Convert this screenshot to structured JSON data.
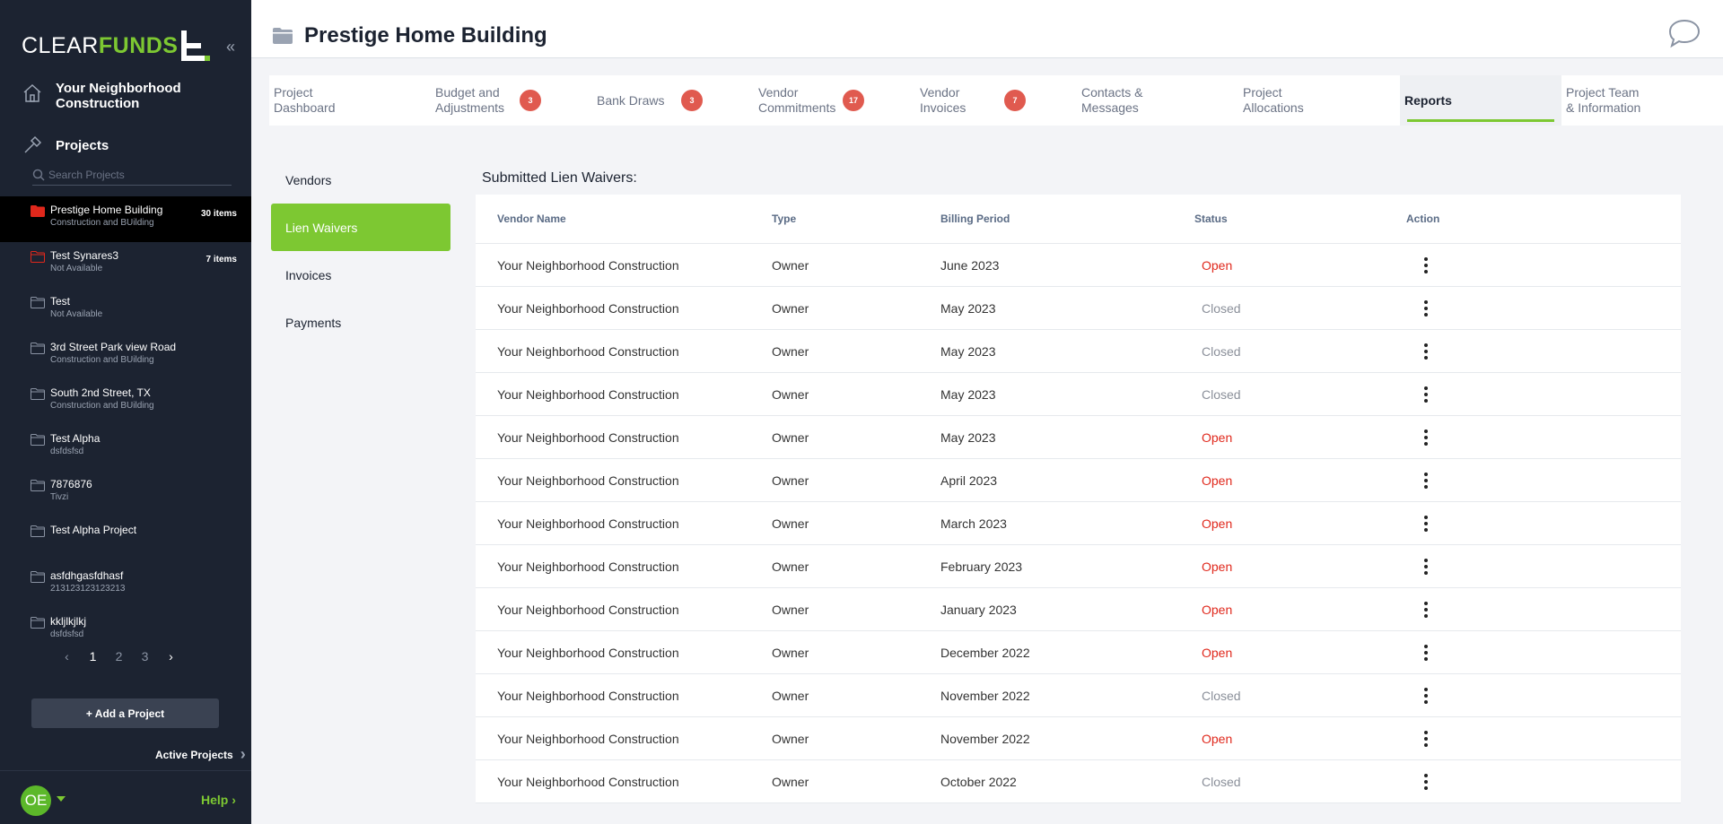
{
  "brand": {
    "clear": "CLEAR",
    "funds": "FUNDS"
  },
  "sidebar": {
    "org_name": "Your Neighborhood Construction",
    "projects_label": "Projects",
    "search_placeholder": "Search Projects",
    "projects": [
      {
        "name": "Prestige Home Building",
        "sub": "Construction and BUilding",
        "count": "30 items",
        "active": true,
        "icon_color": "#e0281c"
      },
      {
        "name": "Test Synares3",
        "sub": "Not Available",
        "count": "7 items",
        "active": false,
        "icon_color": "#e0281c"
      },
      {
        "name": "Test",
        "sub": "Not Available",
        "count": "",
        "active": false,
        "icon_color": "#8a93a3"
      },
      {
        "name": "3rd Street Park view Road",
        "sub": "Construction and BUilding",
        "count": "",
        "active": false,
        "icon_color": "#8a93a3"
      },
      {
        "name": "South 2nd Street, TX",
        "sub": "Construction and BUilding",
        "count": "",
        "active": false,
        "icon_color": "#8a93a3"
      },
      {
        "name": "Test Alpha",
        "sub": "dsfdsfsd",
        "count": "",
        "active": false,
        "icon_color": "#8a93a3"
      },
      {
        "name": "7876876",
        "sub": "Tivzi",
        "count": "",
        "active": false,
        "icon_color": "#8a93a3"
      },
      {
        "name": "Test Alpha Project",
        "sub": "",
        "count": "",
        "active": false,
        "icon_color": "#8a93a3"
      },
      {
        "name": "asfdhgasfdhasf",
        "sub": "213123123123213",
        "count": "",
        "active": false,
        "icon_color": "#8a93a3"
      },
      {
        "name": "kkljlkjlkj",
        "sub": "dsfdsfsd",
        "count": "",
        "active": false,
        "icon_color": "#8a93a3"
      }
    ],
    "pages": [
      "1",
      "2",
      "3"
    ],
    "current_page": "1",
    "add_project": "+ Add a Project",
    "active_projects": "Active Projects",
    "avatar_initials": "OE",
    "help": "Help"
  },
  "header": {
    "title": "Prestige Home Building"
  },
  "tabs": [
    {
      "label": "Project Dashboard",
      "badge": ""
    },
    {
      "label": "Budget and Adjustments",
      "badge": "3"
    },
    {
      "label": "Bank Draws",
      "badge": "3"
    },
    {
      "label": "Vendor Commitments",
      "badge": "17"
    },
    {
      "label": "Vendor Invoices",
      "badge": "7"
    },
    {
      "label": "Contacts & Messages",
      "badge": ""
    },
    {
      "label": "Project Allocations",
      "badge": ""
    },
    {
      "label": "Reports",
      "badge": "",
      "active": true
    },
    {
      "label": "Project Team & Information",
      "badge": ""
    }
  ],
  "subnav": [
    {
      "label": "Vendors",
      "active": false
    },
    {
      "label": "Lien Waivers",
      "active": true
    },
    {
      "label": "Invoices",
      "active": false
    },
    {
      "label": "Payments",
      "active": false
    }
  ],
  "section_title": "Submitted Lien Waivers:",
  "table": {
    "headers": [
      "Vendor Name",
      "Type",
      "Billing Period",
      "Status",
      "Action"
    ],
    "rows": [
      {
        "vendor": "Your Neighborhood Construction",
        "type": "Owner",
        "period": "June 2023",
        "status": "Open"
      },
      {
        "vendor": "Your Neighborhood Construction",
        "type": "Owner",
        "period": "May 2023",
        "status": "Closed"
      },
      {
        "vendor": "Your Neighborhood Construction",
        "type": "Owner",
        "period": "May 2023",
        "status": "Closed"
      },
      {
        "vendor": "Your Neighborhood Construction",
        "type": "Owner",
        "period": "May 2023",
        "status": "Closed"
      },
      {
        "vendor": "Your Neighborhood Construction",
        "type": "Owner",
        "period": "May 2023",
        "status": "Open"
      },
      {
        "vendor": "Your Neighborhood Construction",
        "type": "Owner",
        "period": "April 2023",
        "status": "Open"
      },
      {
        "vendor": "Your Neighborhood Construction",
        "type": "Owner",
        "period": "March 2023",
        "status": "Open"
      },
      {
        "vendor": "Your Neighborhood Construction",
        "type": "Owner",
        "period": "February 2023",
        "status": "Open"
      },
      {
        "vendor": "Your Neighborhood Construction",
        "type": "Owner",
        "period": "January 2023",
        "status": "Open"
      },
      {
        "vendor": "Your Neighborhood Construction",
        "type": "Owner",
        "period": "December 2022",
        "status": "Open"
      },
      {
        "vendor": "Your Neighborhood Construction",
        "type": "Owner",
        "period": "November 2022",
        "status": "Closed"
      },
      {
        "vendor": "Your Neighborhood Construction",
        "type": "Owner",
        "period": "November 2022",
        "status": "Open"
      },
      {
        "vendor": "Your Neighborhood Construction",
        "type": "Owner",
        "period": "October 2022",
        "status": "Closed"
      }
    ]
  },
  "colors": {
    "accent": "#7dc832",
    "sidebar_bg": "#1c2331",
    "open": "#e0281c",
    "closed": "#8a8f99",
    "badge": "#e05a4f"
  }
}
